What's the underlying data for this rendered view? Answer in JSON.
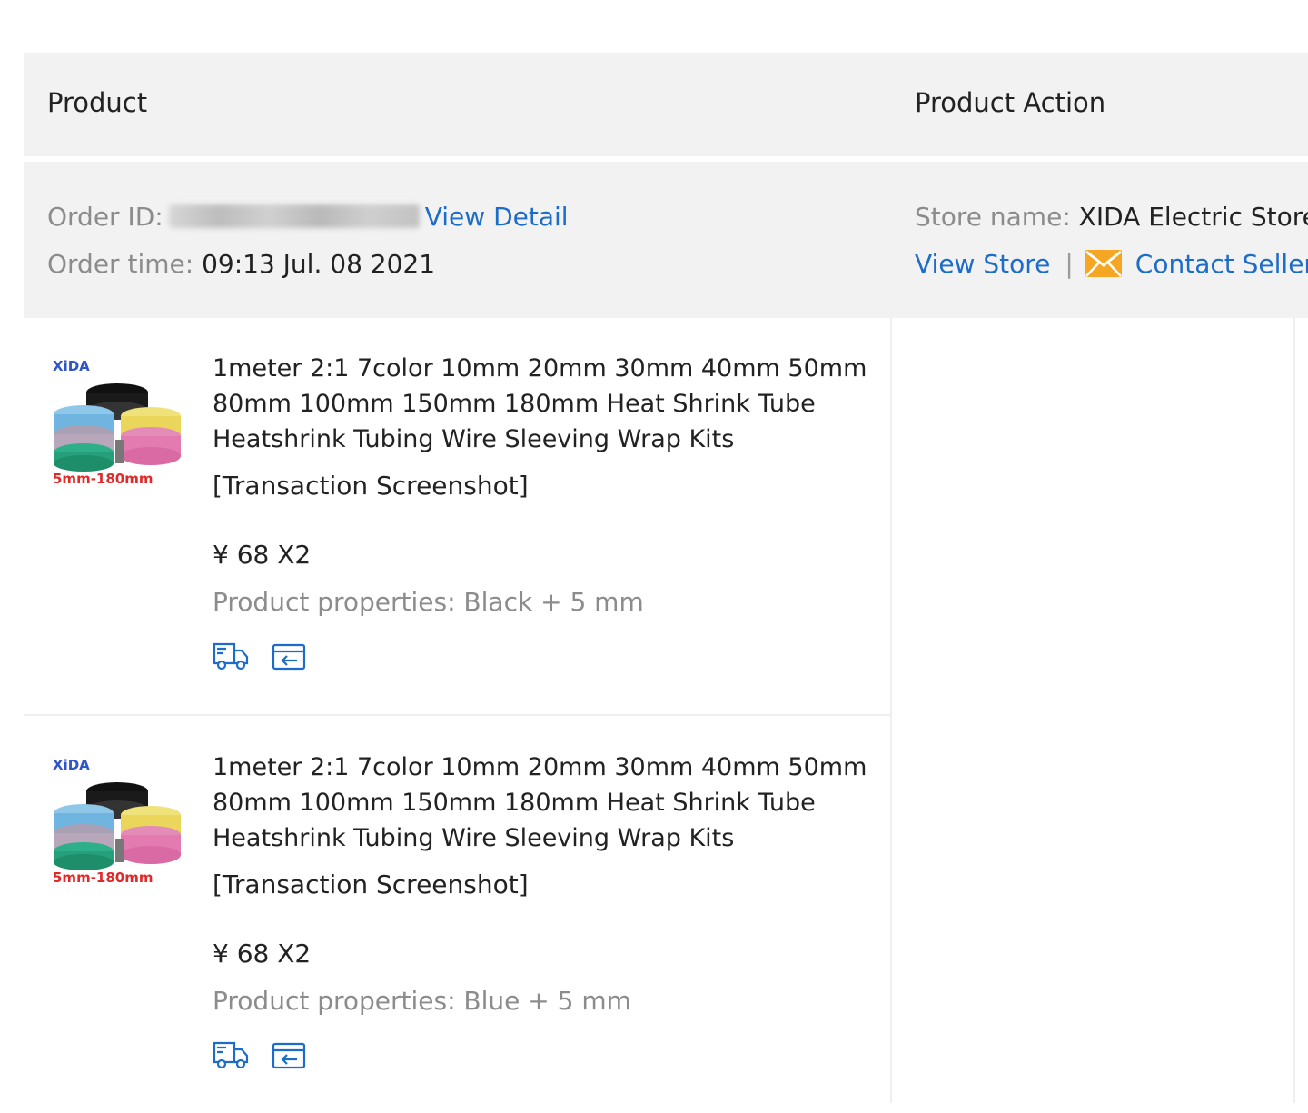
{
  "header": {
    "product_label": "Product",
    "product_action_label": "Product Action"
  },
  "order": {
    "id_label": "Order ID:",
    "view_detail": "View Detail",
    "time_label": "Order time:",
    "time_value": "09:13 Jul. 08 2021",
    "store_label": "Store name:",
    "store_value": "XIDA Electric Store",
    "view_store": "View Store",
    "separator": "|",
    "contact_seller": "Contact Seller"
  },
  "items": [
    {
      "thumb_brand": "XiDA",
      "thumb_caption": "5mm-180mm",
      "title": "1meter 2:1 7color 10mm 20mm 30mm 40mm 50mm 80mm 100mm 150mm 180mm Heat Shrink Tube Heatshrink Tubing Wire Sleeving Wrap Kits",
      "transaction_link": "[Transaction Screenshot]",
      "price": "¥ 68 X2",
      "properties": "Product properties: Black + 5 mm"
    },
    {
      "thumb_brand": "XiDA",
      "thumb_caption": "5mm-180mm",
      "title": "1meter 2:1 7color 10mm 20mm 30mm 40mm 50mm 80mm 100mm 150mm 180mm Heat Shrink Tube Heatshrink Tubing Wire Sleeving Wrap Kits",
      "transaction_link": "[Transaction Screenshot]",
      "price": "¥ 68 X2",
      "properties": "Product properties: Blue + 5 mm"
    }
  ],
  "icons": {
    "shipping": "truck-icon",
    "return": "return-box-icon",
    "mail": "envelope-icon"
  },
  "colors": {
    "link": "#1c6cc9",
    "header_bg": "#f2f2f2",
    "label_gray": "#8c8c8c",
    "mail_orange": "#f5a623"
  }
}
